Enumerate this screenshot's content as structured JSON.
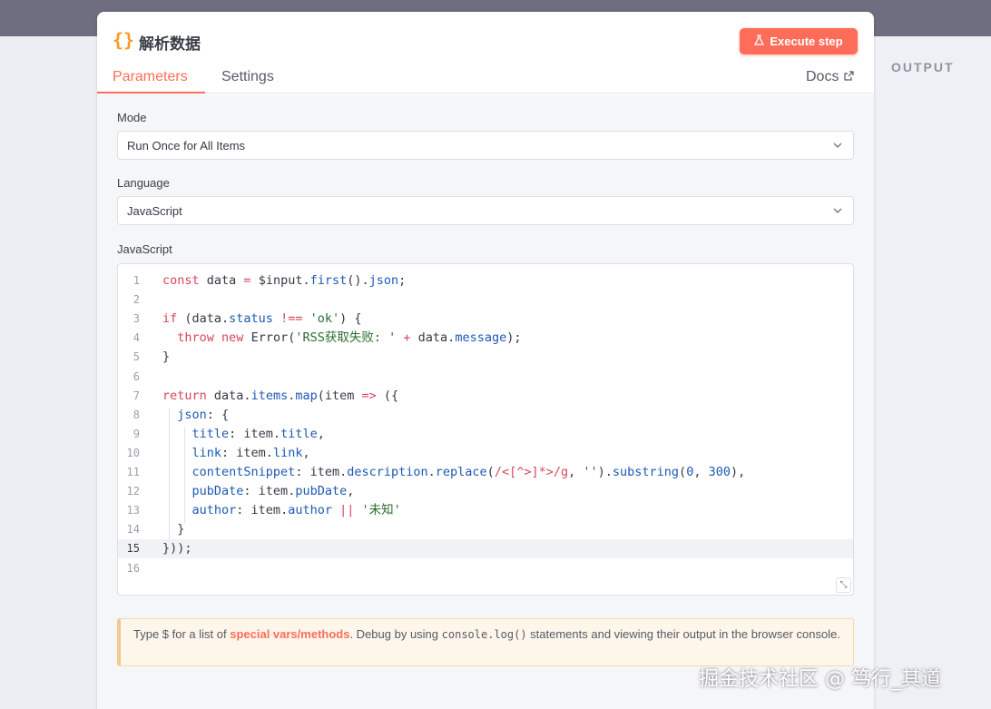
{
  "node": {
    "icon": "{}",
    "title": "解析数据",
    "execute_label": "Execute step"
  },
  "tabs": {
    "parameters": "Parameters",
    "settings": "Settings",
    "docs": "Docs"
  },
  "output_label": "OUTPUT",
  "fields": {
    "mode_label": "Mode",
    "mode_value": "Run Once for All Items",
    "language_label": "Language",
    "language_value": "JavaScript",
    "code_label": "JavaScript"
  },
  "code_lines": [
    {
      "n": "1",
      "text": "const data = $input.first().json;"
    },
    {
      "n": "2",
      "text": ""
    },
    {
      "n": "3",
      "text": "if (data.status !== 'ok') {"
    },
    {
      "n": "4",
      "text": "  throw new Error('RSS获取失败: ' + data.message);"
    },
    {
      "n": "5",
      "text": "}"
    },
    {
      "n": "6",
      "text": ""
    },
    {
      "n": "7",
      "text": "return data.items.map(item => ({"
    },
    {
      "n": "8",
      "text": "  json: {"
    },
    {
      "n": "9",
      "text": "    title: item.title,"
    },
    {
      "n": "10",
      "text": "    link: item.link,"
    },
    {
      "n": "11",
      "text": "    contentSnippet: item.description.replace(/<[^>]*>/g, '').substring(0, 300),"
    },
    {
      "n": "12",
      "text": "    pubDate: item.pubDate,"
    },
    {
      "n": "13",
      "text": "    author: item.author || '未知'"
    },
    {
      "n": "14",
      "text": "  }"
    },
    {
      "n": "15",
      "text": "}));"
    },
    {
      "n": "16",
      "text": ""
    }
  ],
  "active_line": "15",
  "hint": {
    "prefix": "Type $ for a list of ",
    "link": "special vars/methods",
    "middle": ". Debug by using ",
    "code": "console.log()",
    "suffix": " statements and viewing their output in the browser console."
  },
  "watermark": "掘金技术社区 @ 笃行_其道",
  "colors": {
    "accent": "#ff6d5a",
    "icon_orange": "#ff9922",
    "keyword": "#d9455a",
    "property": "#1c59b3"
  }
}
